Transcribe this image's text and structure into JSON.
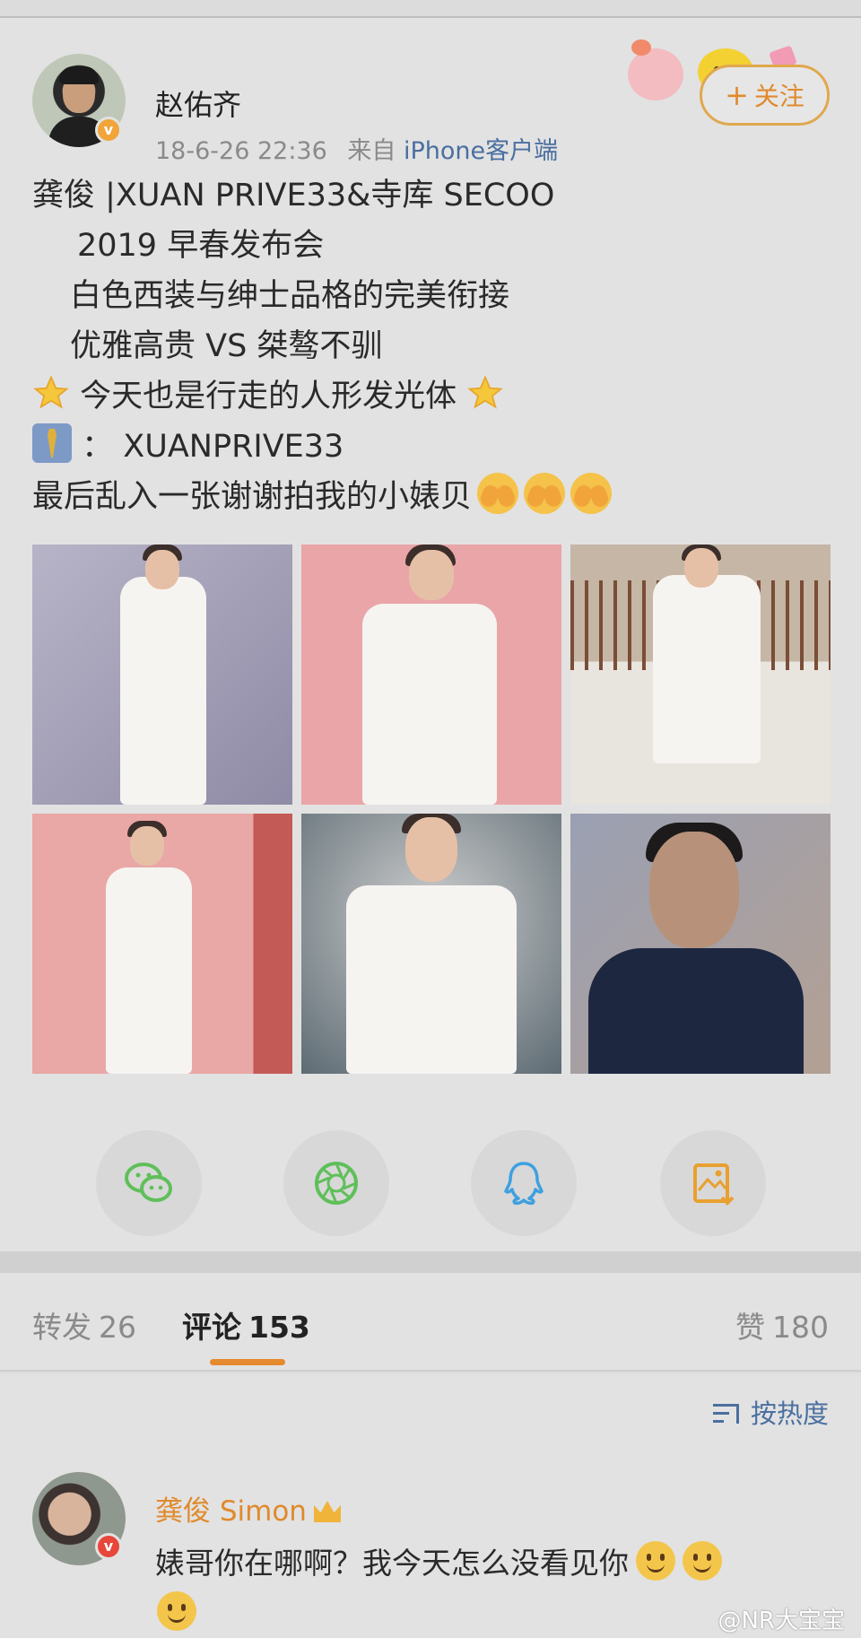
{
  "post": {
    "username": "赵佑齐",
    "time": "18-6-26 22:36",
    "source_prefix": "来自",
    "source": "iPhone客户端",
    "follow_label": "关注",
    "lines": [
      "龚俊 |XUAN PRIVE33&寺库 SECOO",
      "2019 早春发布会",
      "白色西装与绅士品格的完美衔接",
      "优雅高贵 VS 桀骜不驯",
      "今天也是行走的人形发光体",
      "： XUANPRIVE33",
      "最后乱入一张谢谢拍我的小婊贝"
    ],
    "photo_count": 6
  },
  "share": {
    "icons": [
      "wechat-icon",
      "moments-icon",
      "qq-icon",
      "save-image-icon"
    ]
  },
  "tabs": {
    "repost_label": "转发",
    "repost_count": "26",
    "comment_label": "评论",
    "comment_count": "153",
    "like_label": "赞",
    "like_count": "180"
  },
  "sort": {
    "label": "按热度"
  },
  "comment": {
    "name": "龚俊 Simon",
    "text": "婊哥你在哪啊？我今天怎么没看见你"
  },
  "watermark": "@NR大宝宝",
  "colors": {
    "accent_orange": "#e08a2c",
    "link_blue": "#4a6fa0",
    "wechat_green": "#5fbf5a",
    "qq_blue": "#3fa0e0",
    "save_orange": "#e8a030"
  }
}
